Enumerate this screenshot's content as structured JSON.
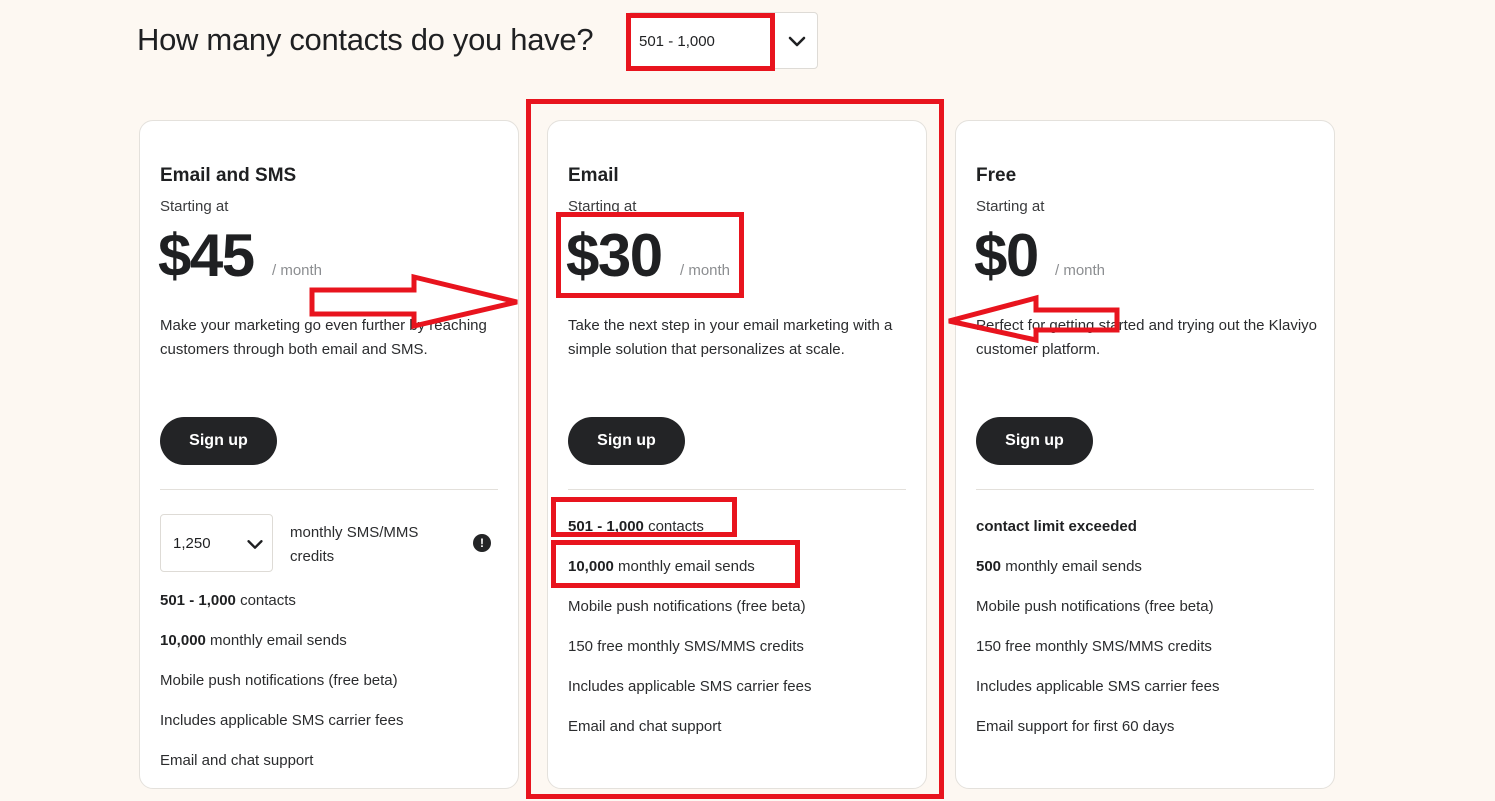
{
  "header": {
    "title": "How many contacts do you have?",
    "contacts_select_value": "501 - 1,000"
  },
  "plans": [
    {
      "name": "Email and SMS",
      "starting_label": "Starting at",
      "price": "$45",
      "per": "/ month",
      "description": "Make your marketing go even further by reaching customers through both email and SMS.",
      "signup_label": "Sign up",
      "sms_credits_select_value": "1,250",
      "sms_credits_label": "monthly SMS/MMS credits",
      "info_icon": "!",
      "features": [
        {
          "bold": "501 - 1,000",
          "text": " contacts"
        },
        {
          "bold": "10,000",
          "text": " monthly email sends"
        },
        {
          "bold": "",
          "text": "Mobile push notifications (free beta)"
        },
        {
          "bold": "",
          "text": "Includes applicable SMS carrier fees"
        },
        {
          "bold": "",
          "text": "Email and chat support"
        }
      ]
    },
    {
      "name": "Email",
      "starting_label": "Starting at",
      "price": "$30",
      "per": "/ month",
      "description": "Take the next step in your email marketing with a simple solution that personalizes at scale.",
      "signup_label": "Sign up",
      "features": [
        {
          "bold": "501 - 1,000",
          "text": " contacts"
        },
        {
          "bold": "10,000",
          "text": " monthly email sends"
        },
        {
          "bold": "",
          "text": "Mobile push notifications (free beta)"
        },
        {
          "bold": "",
          "text": "150 free monthly SMS/MMS credits"
        },
        {
          "bold": "",
          "text": "Includes applicable SMS carrier fees"
        },
        {
          "bold": "",
          "text": "Email and chat support"
        }
      ]
    },
    {
      "name": "Free",
      "starting_label": "Starting at",
      "price": "$0",
      "per": "/ month",
      "description": "Perfect for getting started and trying out the Klaviyo customer platform.",
      "signup_label": "Sign up",
      "features": [
        {
          "bold": "contact limit exceeded",
          "text": ""
        },
        {
          "bold": "500",
          "text": " monthly email sends"
        },
        {
          "bold": "",
          "text": "Mobile push notifications (free beta)"
        },
        {
          "bold": "",
          "text": "150 free monthly SMS/MMS credits"
        },
        {
          "bold": "",
          "text": "Includes applicable SMS carrier fees"
        },
        {
          "bold": "",
          "text": "Email support for first 60 days"
        }
      ]
    }
  ],
  "icons": {
    "chevron": "chevron-down-icon",
    "info": "info-icon"
  },
  "colors": {
    "background": "#fdf8f2",
    "button": "#232426",
    "annotation": "#e8141e"
  }
}
